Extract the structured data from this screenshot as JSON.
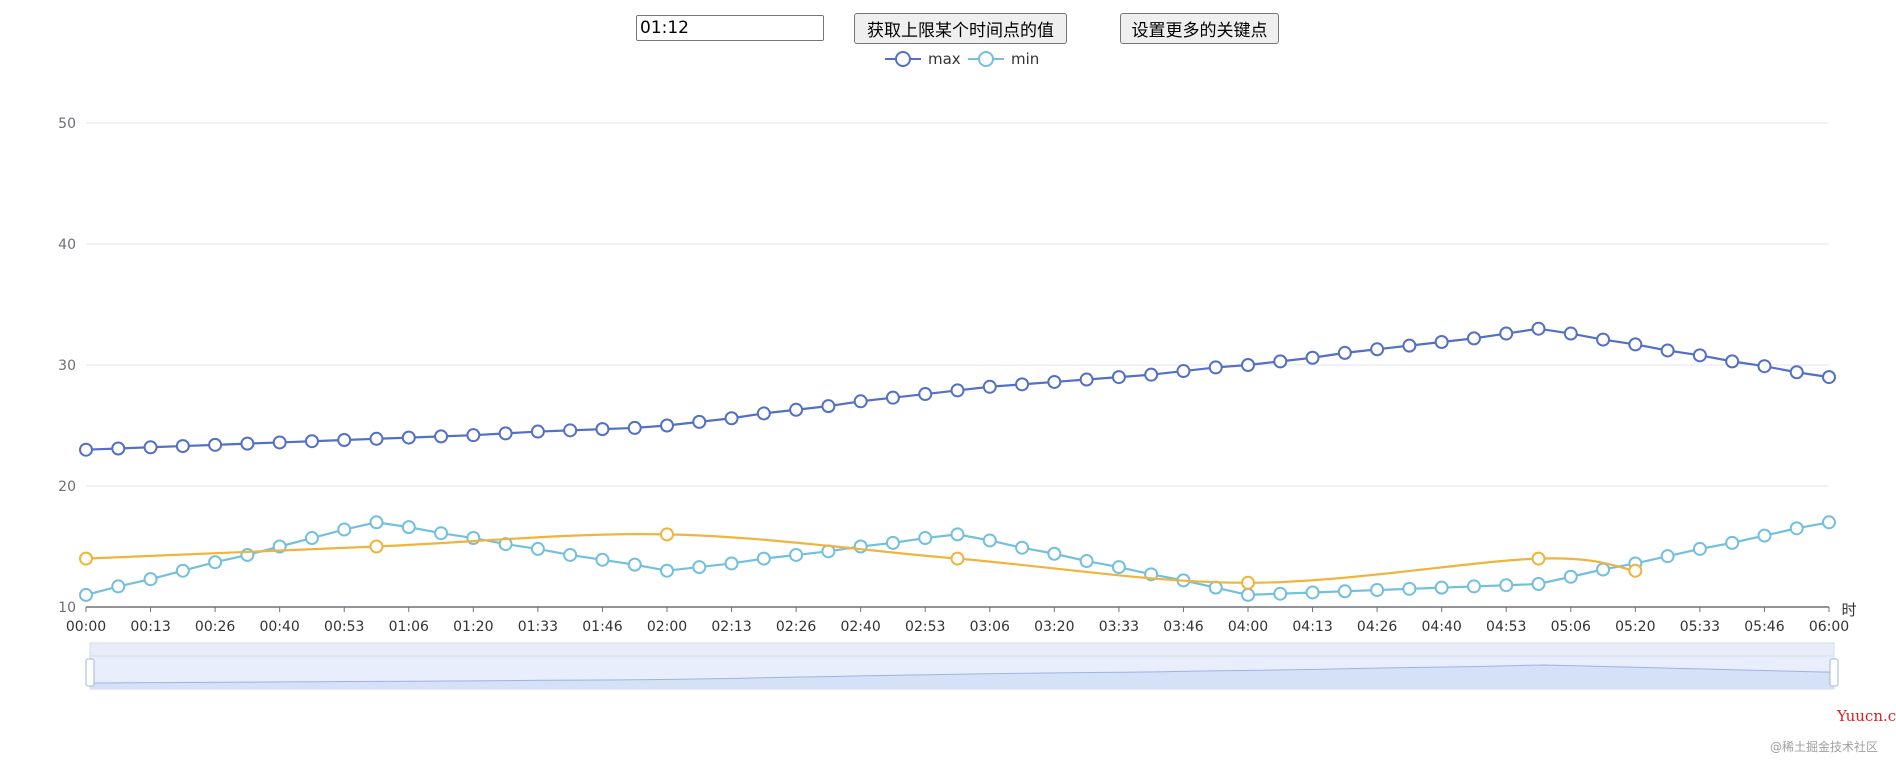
{
  "controls": {
    "time_input_value": "01:12",
    "get_button_label": "获取上限某个时间点的值",
    "set_button_label": "设置更多的关键点"
  },
  "legend": [
    {
      "label": "max",
      "color": "#5470c6"
    },
    {
      "label": "min",
      "color": "#73c0de"
    }
  ],
  "watermark": {
    "site": "Yuucn.com",
    "credit": "@稀土掘金技术社区"
  },
  "chart_data": {
    "type": "line",
    "x_axis": {
      "name": "时",
      "range_minutes": [
        0,
        360
      ],
      "tick_labels": [
        "00:00",
        "00:13",
        "00:26",
        "00:40",
        "00:53",
        "01:06",
        "01:20",
        "01:33",
        "01:46",
        "02:00",
        "02:13",
        "02:26",
        "02:40",
        "02:53",
        "03:06",
        "03:20",
        "03:33",
        "03:46",
        "04:00",
        "04:13",
        "04:26",
        "04:40",
        "04:53",
        "05:06",
        "05:20",
        "05:33",
        "05:46",
        "06:00"
      ]
    },
    "y_axis": {
      "range": [
        10,
        50
      ],
      "ticks": [
        10,
        20,
        30,
        40,
        50
      ]
    },
    "grid": true,
    "legend_position": "top-center",
    "series": [
      {
        "name": "max",
        "color": "#5470c6",
        "x_minutes_step": 6.6667,
        "values": [
          23.0,
          23.1,
          23.2,
          23.3,
          23.4,
          23.5,
          23.6,
          23.7,
          23.8,
          23.9,
          24.0,
          24.1,
          24.2,
          24.35,
          24.5,
          24.6,
          24.7,
          24.8,
          25.0,
          25.3,
          25.6,
          26.0,
          26.3,
          26.6,
          27.0,
          27.3,
          27.6,
          27.9,
          28.2,
          28.4,
          28.6,
          28.8,
          29.0,
          29.2,
          29.5,
          29.8,
          30.0,
          30.3,
          30.6,
          31.0,
          31.3,
          31.6,
          31.9,
          32.2,
          32.6,
          33.0,
          32.6,
          32.1,
          31.7,
          31.2,
          30.8,
          30.3,
          29.9,
          29.4,
          29.0
        ]
      },
      {
        "name": "min",
        "color": "#73c0de",
        "x_minutes_step": 6.6667,
        "values": [
          11.0,
          11.7,
          12.3,
          13.0,
          13.7,
          14.3,
          15.0,
          15.7,
          16.4,
          17.0,
          16.6,
          16.1,
          15.7,
          15.2,
          14.8,
          14.3,
          13.9,
          13.5,
          13.0,
          13.3,
          13.6,
          14.0,
          14.3,
          14.6,
          15.0,
          15.3,
          15.7,
          16.0,
          15.5,
          14.9,
          14.4,
          13.8,
          13.3,
          12.7,
          12.2,
          11.6,
          11.0,
          11.1,
          11.2,
          11.3,
          11.4,
          11.5,
          11.6,
          11.7,
          11.8,
          11.9,
          12.5,
          13.1,
          13.6,
          14.2,
          14.8,
          15.3,
          15.9,
          16.5,
          17.0
        ]
      },
      {
        "name": "",
        "color": "#f0b43c",
        "smooth": true,
        "points": [
          {
            "x": "00:00",
            "y": 14.0
          },
          {
            "x": "01:00",
            "y": 15.0
          },
          {
            "x": "02:00",
            "y": 16.0
          },
          {
            "x": "03:00",
            "y": 14.0
          },
          {
            "x": "04:00",
            "y": 12.0
          },
          {
            "x": "05:00",
            "y": 14.0
          },
          {
            "x": "05:20",
            "y": 13.0
          }
        ]
      }
    ]
  }
}
